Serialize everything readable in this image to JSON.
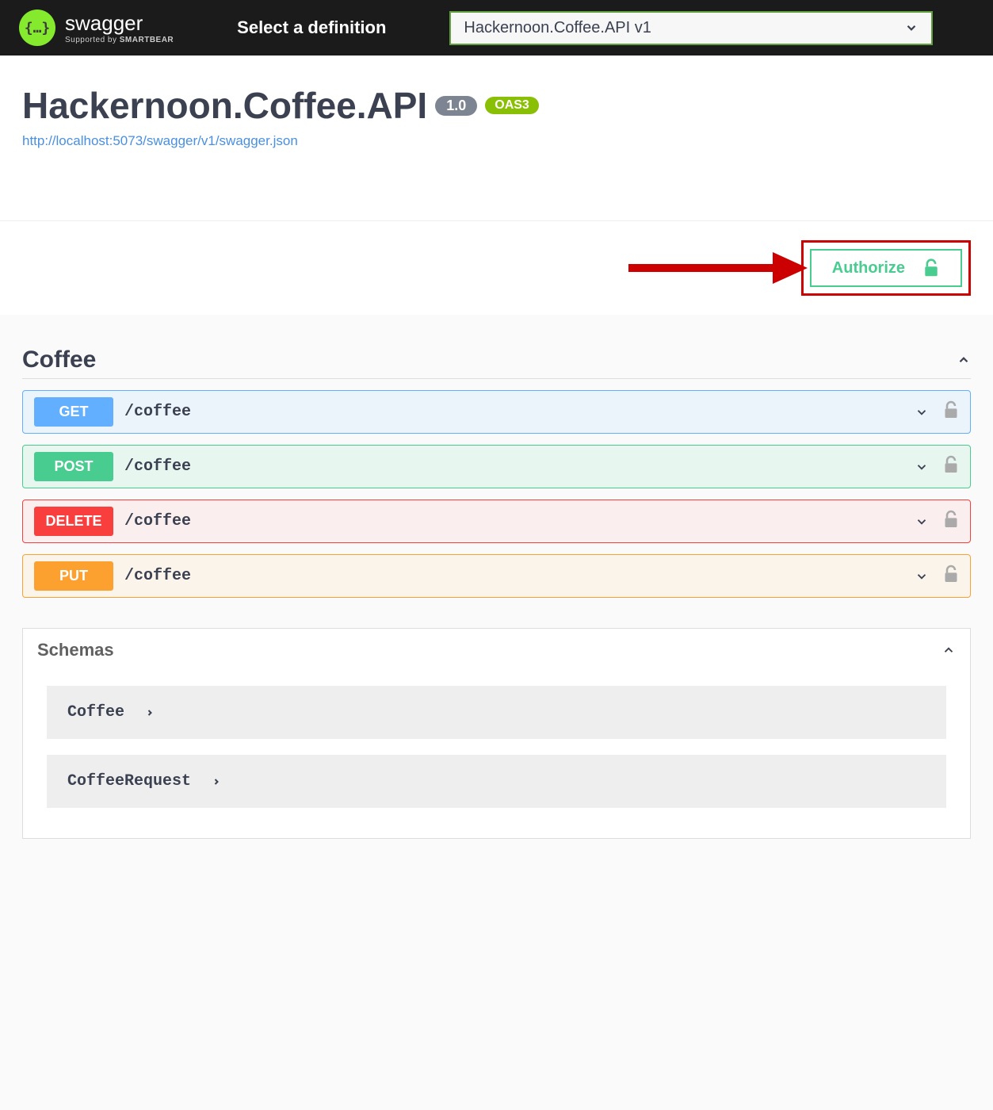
{
  "topbar": {
    "logo_glyph": "{…}",
    "logo_main": "swagger",
    "logo_sub_prefix": "Supported by ",
    "logo_sub_bold": "SMARTBEAR",
    "definition_label": "Select a definition",
    "definition_selected": "Hackernoon.Coffee.API v1"
  },
  "info": {
    "title": "Hackernoon.Coffee.API",
    "version": "1.0",
    "oas": "OAS3",
    "swagger_url": "http://localhost:5073/swagger/v1/swagger.json"
  },
  "auth": {
    "authorize_label": "Authorize"
  },
  "tag": {
    "name": "Coffee"
  },
  "operations": [
    {
      "method": "GET",
      "css": "get",
      "path": "/coffee"
    },
    {
      "method": "POST",
      "css": "post",
      "path": "/coffee"
    },
    {
      "method": "DELETE",
      "css": "delete",
      "path": "/coffee"
    },
    {
      "method": "PUT",
      "css": "put",
      "path": "/coffee"
    }
  ],
  "schemas": {
    "heading": "Schemas",
    "items": [
      "Coffee",
      "CoffeeRequest"
    ]
  }
}
